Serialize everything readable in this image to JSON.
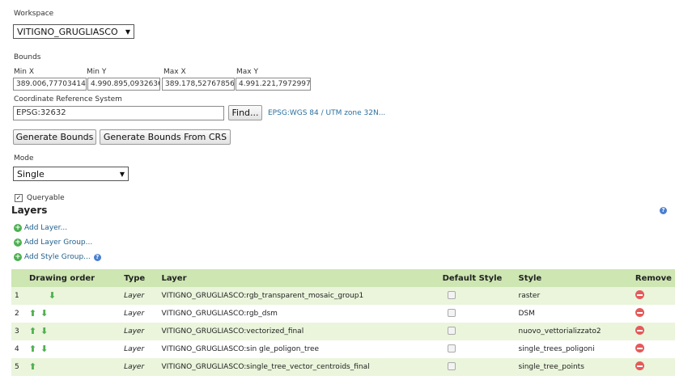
{
  "workspace": {
    "label": "Workspace",
    "value": "VITIGNO_GRUGLIASCO"
  },
  "bounds": {
    "label": "Bounds",
    "fields": [
      {
        "label": "Min X",
        "value": "389.006,77703414"
      },
      {
        "label": "Min Y",
        "value": "4.990.895,0932636"
      },
      {
        "label": "Max X",
        "value": "389.178,52767856"
      },
      {
        "label": "Max Y",
        "value": "4.991.221,7972997"
      }
    ]
  },
  "crs": {
    "label": "Coordinate Reference System",
    "value": "EPSG:32632",
    "find_label": "Find...",
    "link_text": "EPSG:WGS 84 / UTM zone 32N..."
  },
  "buttons": {
    "generate_bounds": "Generate Bounds",
    "generate_from_crs": "Generate Bounds From CRS"
  },
  "mode": {
    "label": "Mode",
    "value": "Single"
  },
  "queryable": {
    "label": "Queryable",
    "checked": true
  },
  "layers": {
    "title": "Layers",
    "add_layer": "Add Layer...",
    "add_layer_group": "Add Layer Group...",
    "add_style_group": "Add Style Group...",
    "columns": [
      "Drawing order",
      "Type",
      "Layer",
      "Default Style",
      "Style",
      "Remove"
    ],
    "rows": [
      {
        "order": "1",
        "type": "Layer",
        "layer": "VITIGNO_GRUGLIASCO:rgb_transparent_mosaic_group1",
        "style": "raster",
        "up": false,
        "down": true
      },
      {
        "order": "2",
        "type": "Layer",
        "layer": "VITIGNO_GRUGLIASCO:rgb_dsm",
        "style": "DSM",
        "up": true,
        "down": true
      },
      {
        "order": "3",
        "type": "Layer",
        "layer": "VITIGNO_GRUGLIASCO:vectorized_final",
        "style": "nuovo_vettorializzato2",
        "up": true,
        "down": true
      },
      {
        "order": "4",
        "type": "Layer",
        "layer": "VITIGNO_GRUGLIASCO:sin gle_poligon_tree",
        "style": "single_trees_poligoni",
        "up": true,
        "down": true
      },
      {
        "order": "5",
        "type": "Layer",
        "layer": "VITIGNO_GRUGLIASCO:single_tree_vector_centroids_final",
        "style": "single_tree_points",
        "up": true,
        "down": false
      }
    ]
  },
  "icons": {
    "add": "plus-circle-icon",
    "help": "help-icon",
    "remove": "remove-icon",
    "up": "arrow-up-icon",
    "down": "arrow-down-icon"
  }
}
